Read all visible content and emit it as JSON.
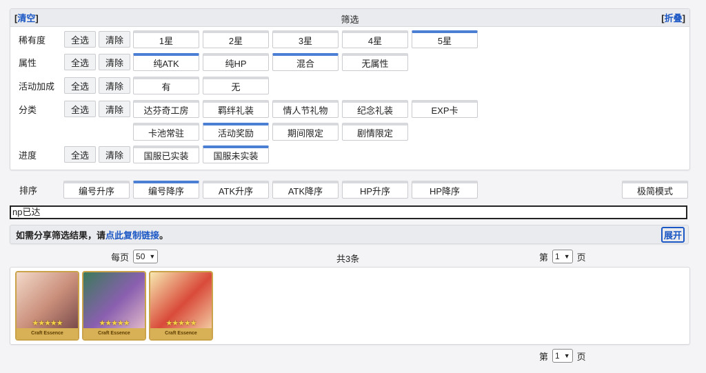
{
  "filter": {
    "title": "筛选",
    "clear": "清空",
    "collapse": "折叠",
    "select_all": "全选",
    "clear_row": "清除",
    "rows": [
      {
        "label": "稀有度",
        "options": [
          {
            "text": "1星",
            "on": false
          },
          {
            "text": "2星",
            "on": false
          },
          {
            "text": "3星",
            "on": false
          },
          {
            "text": "4星",
            "on": false
          },
          {
            "text": "5星",
            "on": true
          }
        ]
      },
      {
        "label": "属性",
        "options": [
          {
            "text": "纯ATK",
            "on": true
          },
          {
            "text": "纯HP",
            "on": false
          },
          {
            "text": "混合",
            "on": true
          },
          {
            "text": "无属性",
            "on": false
          }
        ]
      },
      {
        "label": "活动加成",
        "options": [
          {
            "text": "有",
            "on": false
          },
          {
            "text": "无",
            "on": false
          }
        ]
      },
      {
        "label": "分类",
        "options": [
          {
            "text": "达芬奇工房",
            "on": false
          },
          {
            "text": "羁绊礼装",
            "on": false
          },
          {
            "text": "情人节礼物",
            "on": false
          },
          {
            "text": "纪念礼装",
            "on": false
          },
          {
            "text": "EXP卡",
            "on": false
          }
        ]
      },
      {
        "label": "",
        "options": [
          {
            "text": "卡池常驻",
            "on": false
          },
          {
            "text": "活动奖励",
            "on": true
          },
          {
            "text": "期间限定",
            "on": false
          },
          {
            "text": "剧情限定",
            "on": false
          }
        ]
      },
      {
        "label": "进度",
        "options": [
          {
            "text": "国服已实装",
            "on": false
          },
          {
            "text": "国服未实装",
            "on": true
          }
        ]
      }
    ]
  },
  "sort": {
    "label": "排序",
    "options": [
      {
        "text": "编号升序",
        "on": false
      },
      {
        "text": "编号降序",
        "on": true
      },
      {
        "text": "ATK升序",
        "on": false
      },
      {
        "text": "ATK降序",
        "on": false
      },
      {
        "text": "HP升序",
        "on": false
      },
      {
        "text": "HP降序",
        "on": false
      }
    ],
    "mode": "极简模式"
  },
  "search": {
    "value": "np已达"
  },
  "share": {
    "prefix": "如需分享筛选结果，请",
    "link": "点此复制链接",
    "suffix": "。",
    "expand": "展开"
  },
  "pager": {
    "per_page_label": "每页",
    "per_page_value": "50",
    "total": "共3条",
    "page_prefix": "第",
    "page_value": "1",
    "page_suffix": "页"
  },
  "cards": [
    {
      "stars": "★★★★★",
      "ribbon": "Craft Essence",
      "colors": [
        "#f3d9c9",
        "#c98e7a",
        "#7a4b4b"
      ]
    },
    {
      "stars": "★★★★★",
      "ribbon": "Craft Essence",
      "colors": [
        "#3b7a5a",
        "#8a5fb0",
        "#e0b8c8"
      ]
    },
    {
      "stars": "★★★★★",
      "ribbon": "Craft Essence",
      "colors": [
        "#f7e8b0",
        "#d94a3a",
        "#f2c9a0"
      ]
    }
  ],
  "colors": {
    "accent": "#4a7fd4",
    "link": "#1a56c4",
    "card_border": "#c9a24a"
  }
}
